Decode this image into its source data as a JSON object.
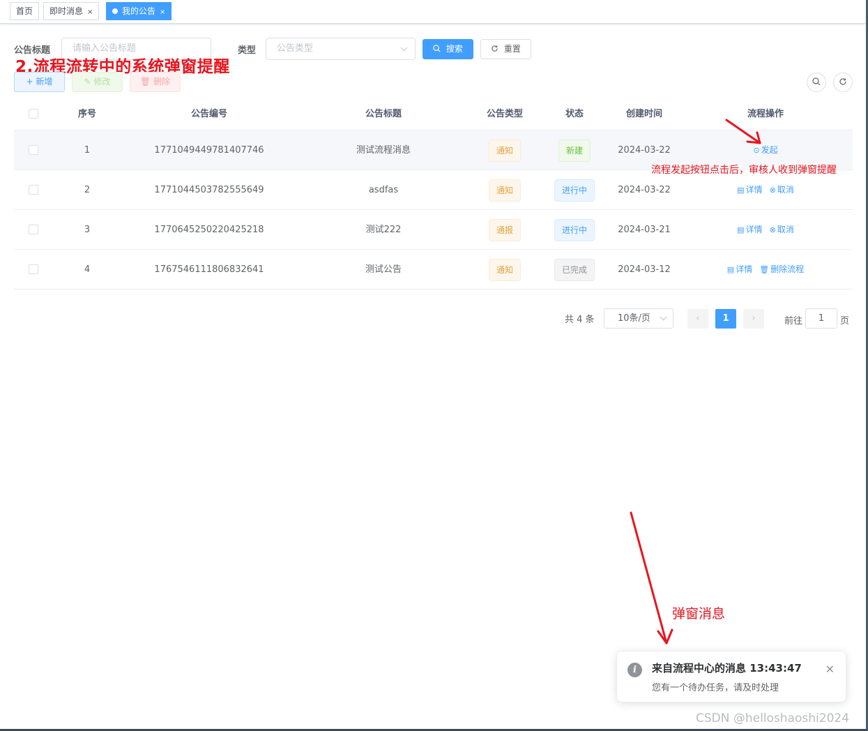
{
  "tags": [
    {
      "label": "首页",
      "active": false,
      "closable": false
    },
    {
      "label": "即时消息",
      "active": false,
      "closable": true
    },
    {
      "label": "我的公告",
      "active": true,
      "closable": true
    }
  ],
  "tag_close": "×",
  "search": {
    "title_label": "公告标题",
    "title_placeholder": "请输入公告标题",
    "type_label": "类型",
    "type_placeholder": "公告类型",
    "search_btn": "搜索",
    "reset_btn": "重置"
  },
  "toolbar": {
    "add": "新增",
    "edit": "修改",
    "delete": "删除"
  },
  "annotations": {
    "title": "2.流程流转中的系统弹窗提醒",
    "op_note": "流程发起按钮点击后，审核人收到弹窗提醒",
    "popup_note": "弹窗消息"
  },
  "table": {
    "columns": [
      "序号",
      "公告编号",
      "公告标题",
      "公告类型",
      "状态",
      "创建时间",
      "流程操作"
    ],
    "rows": [
      {
        "index": "1",
        "id": "1771049449781407746",
        "title": "测试流程消息",
        "type": "通知",
        "status": "新建",
        "status_kind": "success",
        "created": "2024-03-22",
        "ops": [
          {
            "label": "发起",
            "icon": "play-circle-icon"
          }
        ]
      },
      {
        "index": "2",
        "id": "1771044503782555649",
        "title": "asdfas",
        "type": "通知",
        "status": "进行中",
        "status_kind": "info",
        "created": "2024-03-22",
        "ops": [
          {
            "label": "详情",
            "icon": "document-icon"
          },
          {
            "label": "取消",
            "icon": "cancel-circle-icon"
          }
        ]
      },
      {
        "index": "3",
        "id": "1770645250220425218",
        "title": "测试222",
        "type": "通报",
        "status": "进行中",
        "status_kind": "info",
        "created": "2024-03-21",
        "ops": [
          {
            "label": "详情",
            "icon": "document-icon"
          },
          {
            "label": "取消",
            "icon": "cancel-circle-icon"
          }
        ]
      },
      {
        "index": "4",
        "id": "1767546111806832641",
        "title": "测试公告",
        "type": "通知",
        "status": "已完成",
        "status_kind": "gray",
        "created": "2024-03-12",
        "ops": [
          {
            "label": "详情",
            "icon": "document-icon"
          },
          {
            "label": "删除流程",
            "icon": "trash-icon"
          }
        ]
      }
    ]
  },
  "pagination": {
    "total": "共 4 条",
    "page_size": "10条/页",
    "current_page": "1",
    "goto_label": "前往",
    "goto_value": "1",
    "goto_unit": "页"
  },
  "notification": {
    "title": "来自流程中心的消息 13:43:47",
    "message": "您有一个待办任务，请及时处理",
    "icon": "info-icon"
  },
  "watermark": "CSDN @helloshaoshi2024",
  "colors": {
    "primary": "#409eff",
    "annotation_red": "#e8141e",
    "warning": "#e6a23c",
    "success": "#67c23a"
  }
}
